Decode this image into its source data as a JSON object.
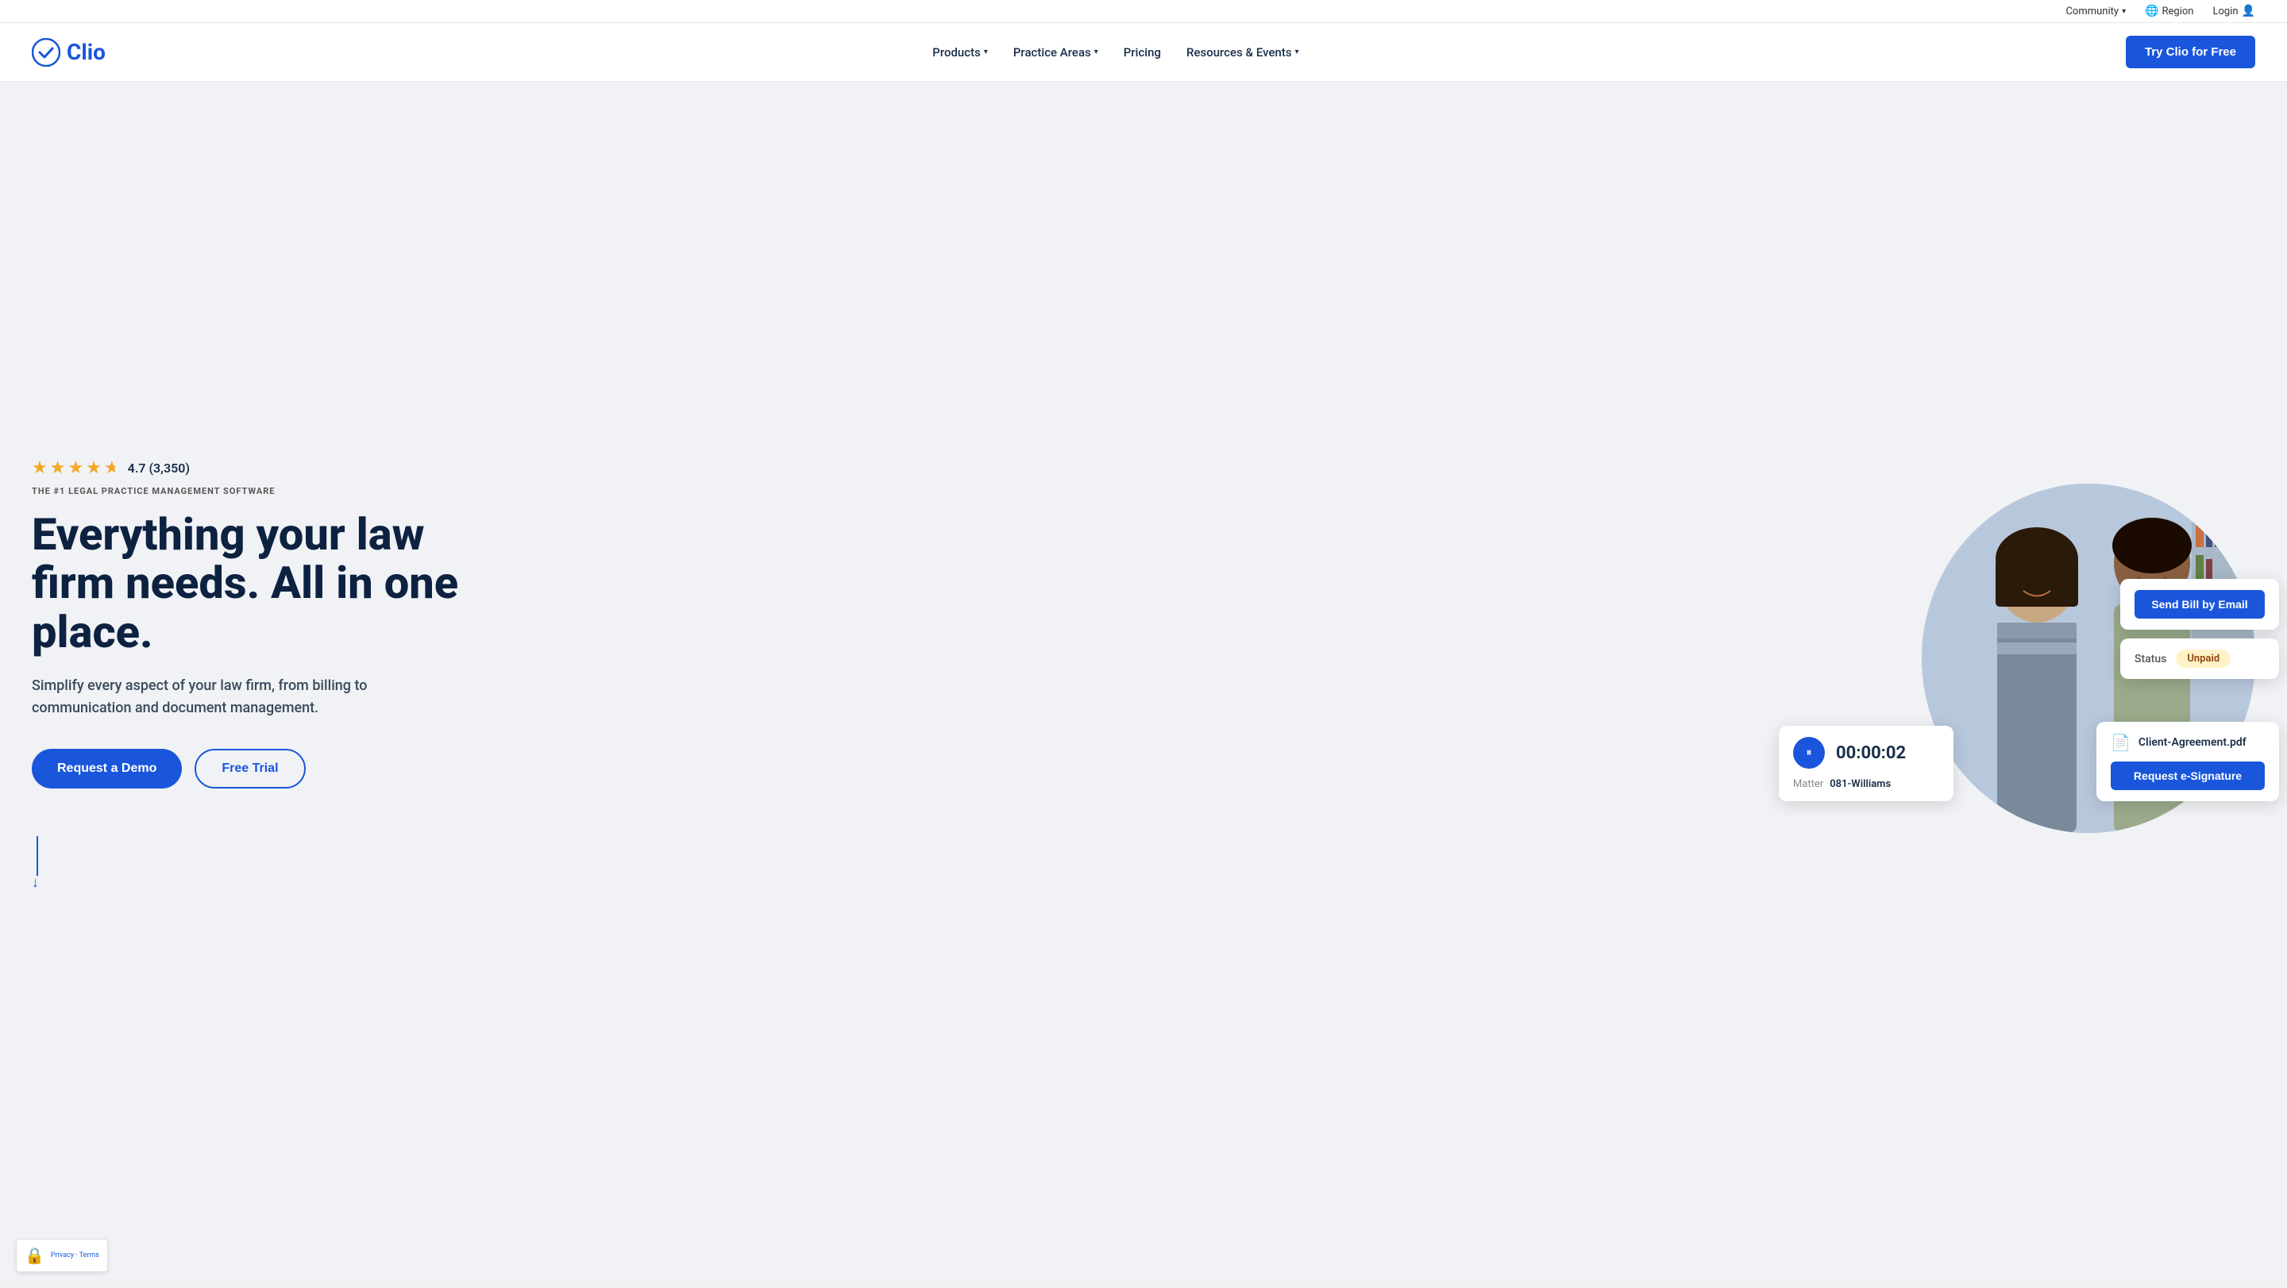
{
  "topbar": {
    "community_label": "Community",
    "region_label": "Region",
    "login_label": "Login"
  },
  "navbar": {
    "logo_text": "Clio",
    "nav_items": [
      {
        "label": "Products",
        "has_dropdown": true
      },
      {
        "label": "Practice Areas",
        "has_dropdown": true
      },
      {
        "label": "Pricing",
        "has_dropdown": false
      },
      {
        "label": "Resources & Events",
        "has_dropdown": true
      }
    ],
    "cta_label": "Try Clio for Free"
  },
  "hero": {
    "rating_value": "4.7 (3,350)",
    "badge_text": "THE #1 LEGAL PRACTICE MANAGEMENT SOFTWARE",
    "headline_line1": "Everything your law",
    "headline_line2": "firm needs. All in one",
    "headline_line3": "place.",
    "subtext": "Simplify every aspect of your law firm, from billing to communication and document management.",
    "btn_demo": "Request a Demo",
    "btn_trial": "Free Trial"
  },
  "ui_cards": {
    "timer": {
      "time": "00:00:02",
      "matter_label": "Matter",
      "matter_value": "081-Williams"
    },
    "bill": {
      "btn_label": "Send Bill by Email"
    },
    "status": {
      "label": "Status",
      "badge": "Unpaid"
    },
    "doc": {
      "filename": "Client-Agreement.pdf",
      "sign_label": "Request e-Signature"
    }
  },
  "recaptcha": {
    "text": "Privacy · Terms"
  }
}
